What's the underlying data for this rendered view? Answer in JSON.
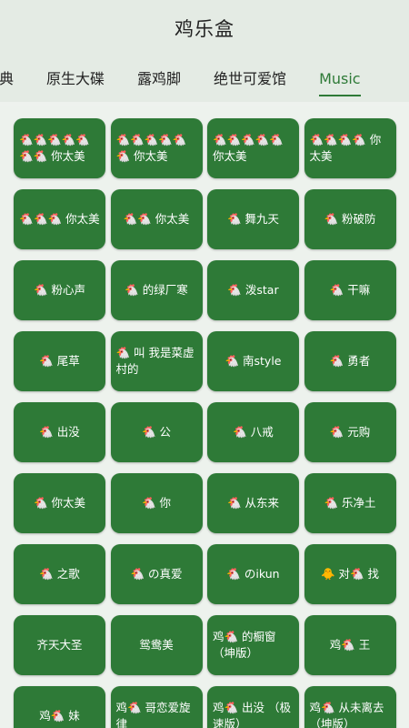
{
  "app": {
    "title": "鸡乐盒"
  },
  "tabs": [
    {
      "label": "经典",
      "active": false
    },
    {
      "label": "原生大碟",
      "active": false
    },
    {
      "label": "露鸡脚",
      "active": false
    },
    {
      "label": "绝世可爱馆",
      "active": false
    },
    {
      "label": "Music",
      "active": true
    }
  ],
  "colors": {
    "accent": "#2e7a37",
    "tile": "#2e7a37",
    "background": "#edf2ed",
    "header": "#e4ebe4"
  },
  "tiles": [
    {
      "label": "🐔🐔🐔🐔🐔🐔🐔 你太美",
      "align": "left"
    },
    {
      "label": "🐔🐔🐔🐔🐔🐔 你太美",
      "align": "left"
    },
    {
      "label": "🐔🐔🐔🐔🐔 你太美",
      "align": "left"
    },
    {
      "label": "🐔🐔🐔🐔 你太美",
      "align": "left"
    },
    {
      "label": "🐔🐔🐔 你太美",
      "align": "center"
    },
    {
      "label": "🐔🐔 你太美",
      "align": "center"
    },
    {
      "label": "🐔 舞九天",
      "align": "center"
    },
    {
      "label": "🐔 粉破防",
      "align": "center"
    },
    {
      "label": "🐔 粉心声",
      "align": "center"
    },
    {
      "label": "🐔 的绿厂寒",
      "align": "center"
    },
    {
      "label": "🐔 泼star",
      "align": "center"
    },
    {
      "label": "🐔 干嘛",
      "align": "center"
    },
    {
      "label": "🐔 尾草",
      "align": "center"
    },
    {
      "label": "🐔 叫 我是菜虚村的",
      "align": "left"
    },
    {
      "label": "🐔 南style",
      "align": "center"
    },
    {
      "label": "🐔 勇者",
      "align": "center"
    },
    {
      "label": "🐔 出没",
      "align": "center"
    },
    {
      "label": "🐔 公",
      "align": "center"
    },
    {
      "label": "🐔 八戒",
      "align": "center"
    },
    {
      "label": "🐔 元购",
      "align": "center"
    },
    {
      "label": "🐔 你太美",
      "align": "center"
    },
    {
      "label": "🐔 你",
      "align": "center"
    },
    {
      "label": "🐔 从东来",
      "align": "center"
    },
    {
      "label": "🐔 乐净土",
      "align": "center"
    },
    {
      "label": "🐔 之歌",
      "align": "center"
    },
    {
      "label": "🐔 の真爱",
      "align": "center"
    },
    {
      "label": "🐔 のikun",
      "align": "center"
    },
    {
      "label": "🐥 对🐔 找",
      "align": "center"
    },
    {
      "label": "齐天大圣",
      "align": "center"
    },
    {
      "label": "鸳鸯美",
      "align": "center"
    },
    {
      "label": "鸡🐔 的橱窗（坤版）",
      "align": "left"
    },
    {
      "label": "鸡🐔 王",
      "align": "center"
    },
    {
      "label": "鸡🐔 妹",
      "align": "center"
    },
    {
      "label": "鸡🐔 哥恋爱旋律",
      "align": "left"
    },
    {
      "label": "鸡🐔 出没 （极速版）",
      "align": "left"
    },
    {
      "label": "鸡🐔 从未离去（坤版）",
      "align": "left"
    }
  ]
}
